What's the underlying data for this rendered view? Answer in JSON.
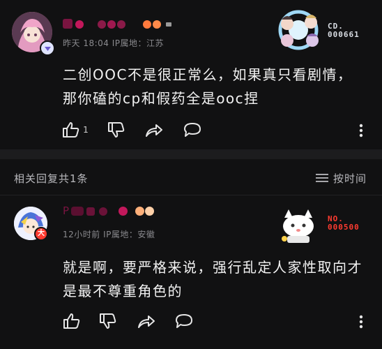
{
  "colors": {
    "background": "#111112",
    "section_bar": "#1c1c1e",
    "text": "#f2f2f2",
    "meta": "#8a8a8e",
    "name_accent_1": "#c2185b",
    "name_accent_2": "#ff7a3d",
    "badge_red": "#ff3b30"
  },
  "top_comment": {
    "meta": "昨天 18:04 IP属地：江苏",
    "text": "二创OOC不是很正常么，如果真只看剧情，那你磕的cp和假药全是ooc捏",
    "like_count": "1",
    "badge": {
      "label": "CD.",
      "number": "000661"
    },
    "icons": [
      "thumbs-up-icon",
      "thumbs-down-icon",
      "share-icon",
      "comment-icon",
      "more-icon"
    ]
  },
  "replies_header": {
    "title": "相关回复共1条",
    "sort_label": "按时间",
    "sort_icon": "list-icon"
  },
  "reply": {
    "name_partial": "P",
    "meta": "12小时前 IP属地：安徽",
    "text": "就是啊，要严格来说，强行乱定人家性取向才是最不尊重角色的",
    "avatar_badge": "大",
    "badge": {
      "label": "NO.",
      "number": "000500"
    },
    "icons": [
      "thumbs-up-icon",
      "thumbs-down-icon",
      "share-icon",
      "comment-icon",
      "more-icon"
    ]
  }
}
